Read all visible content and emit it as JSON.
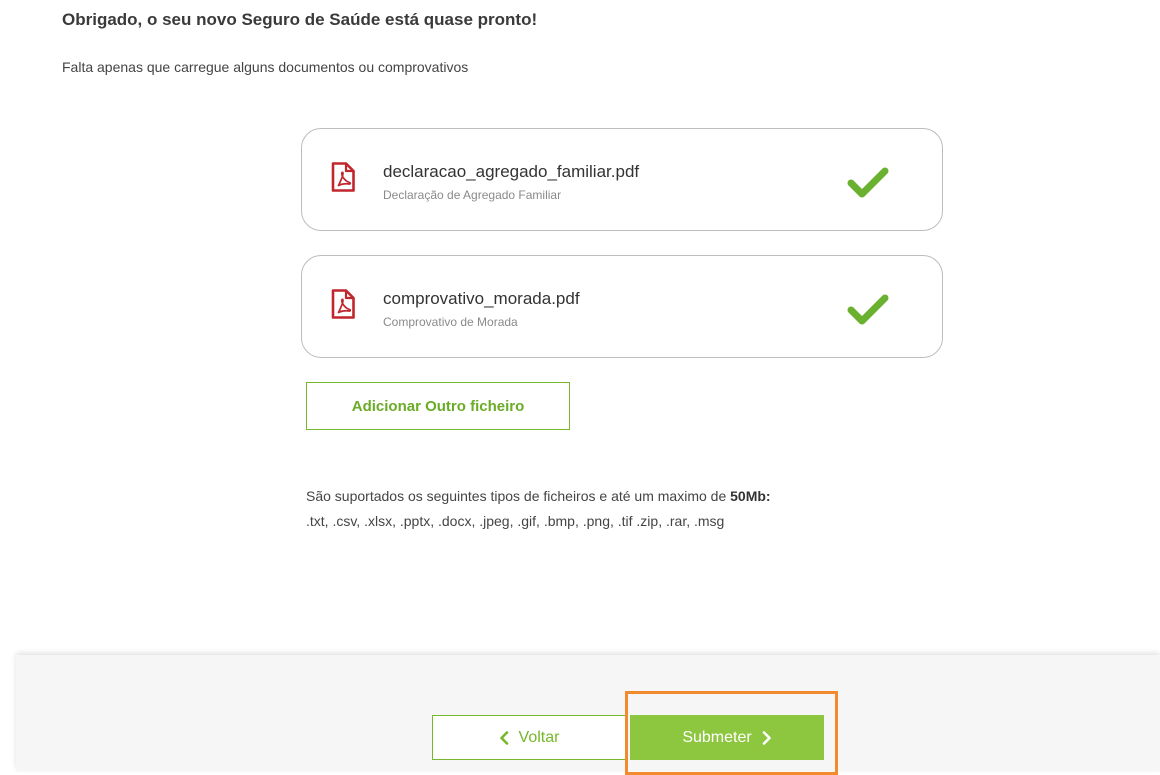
{
  "header": {
    "title": "Obrigado, o seu novo Seguro de Saúde está quase pronto!",
    "subtitle": "Falta apenas que carregue alguns documentos ou comprovativos"
  },
  "files": [
    {
      "name": "declaracao_agregado_familiar.pdf",
      "description": "Declaração de Agregado Familiar",
      "icon": "pdf-icon",
      "status": "uploaded"
    },
    {
      "name": "comprovativo_morada.pdf",
      "description": "Comprovativo de Morada",
      "icon": "pdf-icon",
      "status": "uploaded"
    }
  ],
  "add_file_label": "Adicionar Outro ficheiro",
  "info": {
    "supported_text": "São suportados os seguintes tipos de ficheiros e até um maximo de ",
    "size_limit": "50Mb:",
    "file_types": ".txt, .csv, .xlsx, .pptx, .docx, .jpeg, .gif, .bmp, .png, .tif .zip, .rar, .msg"
  },
  "footer": {
    "back_label": "Voltar",
    "submit_label": "Submeter"
  },
  "colors": {
    "accent_green": "#8dc63f",
    "border_green": "#76b82a",
    "pdf_red": "#c0272d",
    "highlight_orange": "#f28a2e"
  }
}
